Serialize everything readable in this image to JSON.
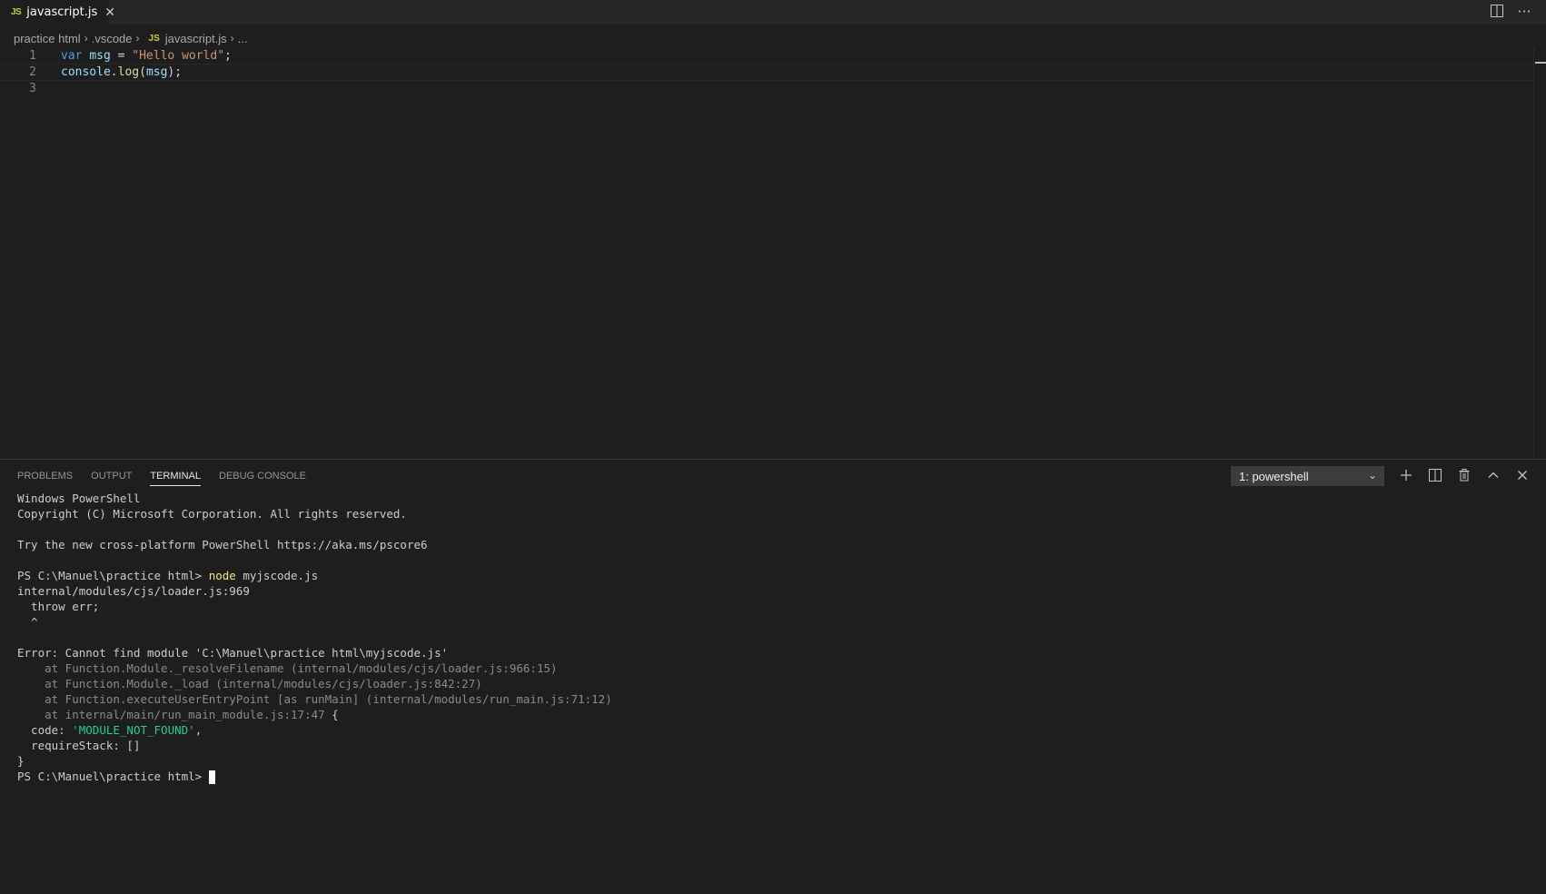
{
  "tabbar": {
    "tab": {
      "badge": "JS",
      "label": "javascript.js",
      "close": "✕"
    },
    "actions": {
      "split_icon": "split-editor-icon",
      "more_icon": "more-actions-icon",
      "more_label": "···"
    }
  },
  "breadcrumb": {
    "items": [
      "practice html",
      ".vscode",
      "javascript.js",
      "..."
    ],
    "js_badge": "JS",
    "sep": "›"
  },
  "editor": {
    "lines": [
      {
        "num": "1",
        "tokens": [
          {
            "t": "var",
            "c": "kw"
          },
          {
            "t": " ",
            "c": "plain"
          },
          {
            "t": "msg",
            "c": "var"
          },
          {
            "t": " = ",
            "c": "plain"
          },
          {
            "t": "\"Hello world\"",
            "c": "str"
          },
          {
            "t": ";",
            "c": "plain"
          }
        ]
      },
      {
        "num": "2",
        "tokens": [
          {
            "t": "console",
            "c": "var"
          },
          {
            "t": ".",
            "c": "plain"
          },
          {
            "t": "log",
            "c": "fn"
          },
          {
            "t": "(",
            "c": "plain"
          },
          {
            "t": "msg",
            "c": "var"
          },
          {
            "t": ");",
            "c": "plain"
          }
        ]
      },
      {
        "num": "3",
        "tokens": []
      }
    ]
  },
  "panel": {
    "tabs": [
      "PROBLEMS",
      "OUTPUT",
      "TERMINAL",
      "DEBUG CONSOLE"
    ],
    "active_tab": "TERMINAL",
    "terminal_select": "1: powershell",
    "actions": [
      "add-terminal-icon",
      "split-terminal-icon",
      "trash-icon",
      "chevron-up-icon",
      "close-icon"
    ]
  },
  "terminal": {
    "lines": [
      {
        "segments": [
          {
            "t": "Windows PowerShell",
            "c": ""
          }
        ]
      },
      {
        "segments": [
          {
            "t": "Copyright (C) Microsoft Corporation. All rights reserved.",
            "c": ""
          }
        ]
      },
      {
        "segments": [
          {
            "t": "",
            "c": ""
          }
        ]
      },
      {
        "segments": [
          {
            "t": "Try the new cross-platform PowerShell https://aka.ms/pscore6",
            "c": ""
          }
        ]
      },
      {
        "segments": [
          {
            "t": "",
            "c": ""
          }
        ]
      },
      {
        "segments": [
          {
            "t": "PS C:\\Manuel\\practice html> ",
            "c": ""
          },
          {
            "t": "node",
            "c": "yellow"
          },
          {
            "t": " myjscode.js",
            "c": ""
          }
        ]
      },
      {
        "segments": [
          {
            "t": "internal/modules/cjs/loader.js:969",
            "c": ""
          }
        ]
      },
      {
        "segments": [
          {
            "t": "  throw err;",
            "c": ""
          }
        ]
      },
      {
        "segments": [
          {
            "t": "  ^",
            "c": ""
          }
        ]
      },
      {
        "segments": [
          {
            "t": "",
            "c": ""
          }
        ]
      },
      {
        "segments": [
          {
            "t": "Error: Cannot find module 'C:\\Manuel\\practice html\\myjscode.js'",
            "c": ""
          }
        ]
      },
      {
        "segments": [
          {
            "t": "    at Function.Module._resolveFilename (internal/modules/cjs/loader.js:966:15)",
            "c": "dim"
          }
        ]
      },
      {
        "segments": [
          {
            "t": "    at Function.Module._load (internal/modules/cjs/loader.js:842:27)",
            "c": "dim"
          }
        ]
      },
      {
        "segments": [
          {
            "t": "    at Function.executeUserEntryPoint [as runMain] (internal/modules/run_main.js:71:12)",
            "c": "dim"
          }
        ]
      },
      {
        "segments": [
          {
            "t": "    at internal/main/run_main_module.js:17:47",
            "c": "dim"
          },
          {
            "t": " {",
            "c": ""
          }
        ]
      },
      {
        "segments": [
          {
            "t": "  code: ",
            "c": ""
          },
          {
            "t": "'MODULE_NOT_FOUND'",
            "c": "green"
          },
          {
            "t": ",",
            "c": ""
          }
        ]
      },
      {
        "segments": [
          {
            "t": "  requireStack: []",
            "c": ""
          }
        ]
      },
      {
        "segments": [
          {
            "t": "}",
            "c": ""
          }
        ]
      },
      {
        "segments": [
          {
            "t": "PS C:\\Manuel\\practice html> ",
            "c": ""
          }
        ],
        "cursor": true
      }
    ]
  }
}
